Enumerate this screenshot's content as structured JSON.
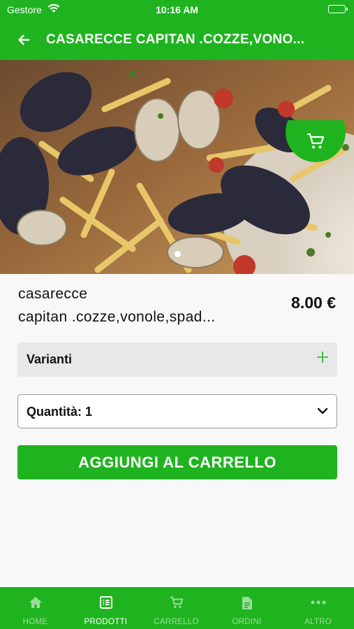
{
  "status_bar": {
    "carrier": "Gestore",
    "time": "10:16 AM"
  },
  "app_bar": {
    "title": "CASARECCE CAPITAN .COZZE,VONO..."
  },
  "product": {
    "name_line1": "casarecce",
    "name_line2": "capitan .cozze,vonole,spad...",
    "price": "8.00 €",
    "image_count": 1,
    "image_index": 1
  },
  "variants": {
    "label": "Varianti"
  },
  "quantity": {
    "label": "Quantità: 1"
  },
  "add_to_cart": {
    "label": "AGGIUNGI AL CARRELLO"
  },
  "tabs": [
    {
      "label": "HOME",
      "icon": "home-icon",
      "active": false
    },
    {
      "label": "PRODOTTI",
      "icon": "list-icon",
      "active": true
    },
    {
      "label": "CARRELLO",
      "icon": "cart-icon",
      "active": false
    },
    {
      "label": "ORDINI",
      "icon": "document-icon",
      "active": false
    },
    {
      "label": "ALTRO",
      "icon": "more-icon",
      "active": false
    }
  ],
  "colors": {
    "brand_green": "#1fb41f",
    "variants_bg": "#e8e8e8",
    "page_bg": "#f8f8f8"
  }
}
